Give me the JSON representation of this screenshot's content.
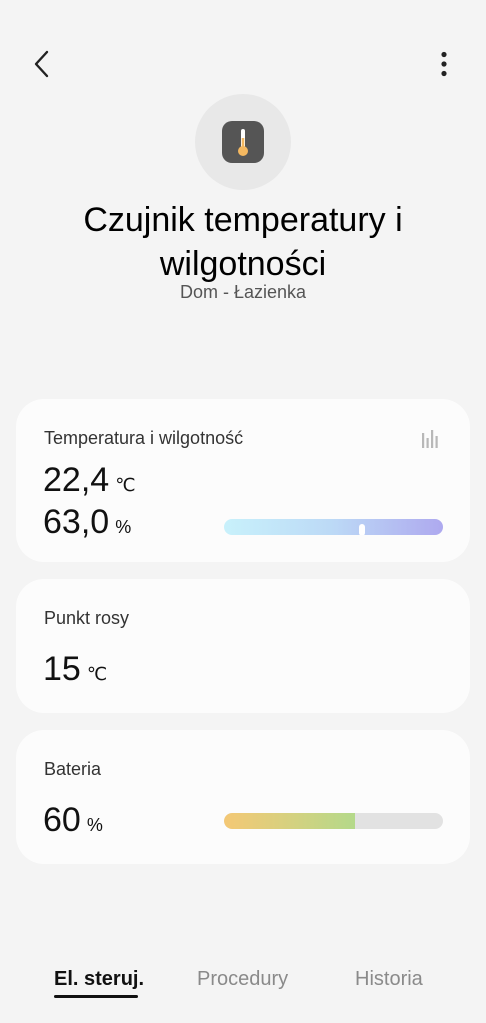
{
  "header": {
    "back_icon": "chevron-left-icon",
    "more_icon": "more-vertical-icon"
  },
  "device": {
    "icon": "thermometer-icon",
    "name": "Czujnik temperatury i wilgotności",
    "location": "Dom - Łazienka"
  },
  "cards": {
    "temp_humidity": {
      "label": "Temperatura i wilgotność",
      "temperature": "22,4",
      "temperature_unit": "℃",
      "humidity": "63,0",
      "humidity_unit": "%",
      "humidity_level_pct": 63,
      "history_icon": "bar-chart-icon"
    },
    "dew_point": {
      "label": "Punkt rosy",
      "value": "15",
      "unit": "℃"
    },
    "battery": {
      "label": "Bateria",
      "value": "60",
      "unit": "%",
      "level_pct": 60
    }
  },
  "tabs": [
    {
      "label": "El. steruj.",
      "active": true
    },
    {
      "label": "Procedury",
      "active": false
    },
    {
      "label": "Historia",
      "active": false
    }
  ],
  "colors": {
    "background": "#f4f4f4",
    "card": "#fcfcfc",
    "thermometer_fill": "#f4b860"
  }
}
